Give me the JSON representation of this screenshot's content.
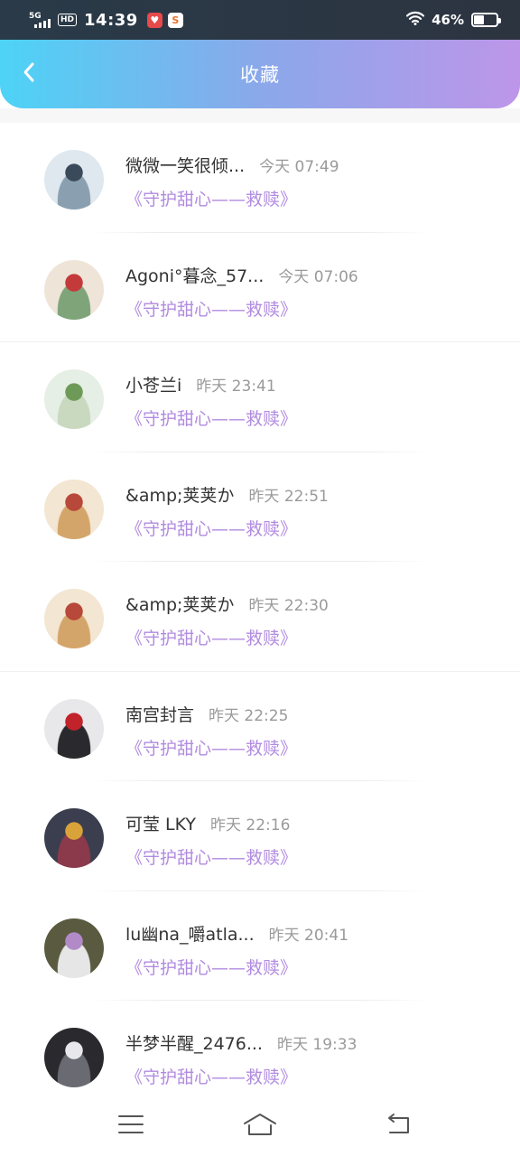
{
  "status_bar": {
    "network": "5G",
    "hd": "HD",
    "time": "14:39",
    "battery": "46%",
    "battery_level": 0.46
  },
  "header": {
    "title": "收藏"
  },
  "items": [
    {
      "nickname": "微微一笑很倾...",
      "time": "今天 07:49",
      "work": "《守护甜心——救赎》",
      "avatar_colors": [
        "#dfe8ee",
        "#3a4a5a",
        "#8aa0b0"
      ]
    },
    {
      "nickname": "Agoni°暮念_57...",
      "time": "今天 07:06",
      "work": "《守护甜心——救赎》",
      "avatar_colors": [
        "#efe4d8",
        "#c43a3a",
        "#7fa47a"
      ]
    },
    {
      "nickname": "小苍兰i",
      "time": "昨天 23:41",
      "work": "《守护甜心——救赎》",
      "avatar_colors": [
        "#e6efe6",
        "#6e9a58",
        "#c9d9c0"
      ]
    },
    {
      "nickname": "&amp;荚荚か",
      "time": "昨天 22:51",
      "work": "《守护甜心——救赎》",
      "avatar_colors": [
        "#f3e6d2",
        "#b7483a",
        "#d4a56a"
      ]
    },
    {
      "nickname": "&amp;荚荚か",
      "time": "昨天 22:30",
      "work": "《守护甜心——救赎》",
      "avatar_colors": [
        "#f3e6d2",
        "#b7483a",
        "#d4a56a"
      ]
    },
    {
      "nickname": "南宫封言",
      "time": "昨天 22:25",
      "work": "《守护甜心——救赎》",
      "avatar_colors": [
        "#e8e8ea",
        "#c2222a",
        "#2a2a2e"
      ]
    },
    {
      "nickname": "可莹 LKY",
      "time": "昨天 22:16",
      "work": "《守护甜心——救赎》",
      "avatar_colors": [
        "#3a3e4e",
        "#d9a33a",
        "#8a3a4a"
      ]
    },
    {
      "nickname": "lu幽na_嚼atla...",
      "time": "昨天 20:41",
      "work": "《守护甜心——救赎》",
      "avatar_colors": [
        "#5a5a40",
        "#b28ac8",
        "#e6e6e6"
      ]
    },
    {
      "nickname": "半梦半醒_2476...",
      "time": "昨天 19:33",
      "work": "《守护甜心——救赎》",
      "avatar_colors": [
        "#2a2a2e",
        "#e8e8ec",
        "#6a6a72"
      ]
    }
  ],
  "icons": {
    "back": "chevron-left-icon",
    "menu": "menu-icon",
    "home": "home-icon",
    "return": "return-icon"
  },
  "colors": {
    "accent_work_title": "#b18be0",
    "header_gradient_start": "#4dd3f6",
    "header_gradient_end": "#bd96e9"
  }
}
